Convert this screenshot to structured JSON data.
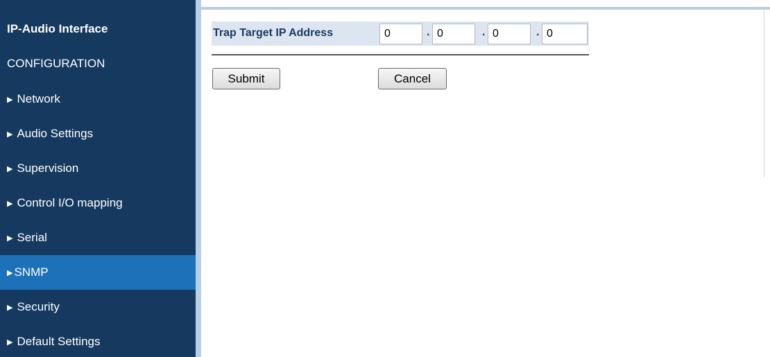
{
  "sidebar": {
    "title": "IP-Audio Interface",
    "section": "CONFIGURATION",
    "arrow": "▶",
    "items": [
      {
        "label": "Network"
      },
      {
        "label": "Audio Settings"
      },
      {
        "label": "Supervision"
      },
      {
        "label": "Control I/O mapping"
      },
      {
        "label": "Serial"
      },
      {
        "label": "SNMP",
        "active": true
      },
      {
        "label": "Security"
      },
      {
        "label": "Default Settings"
      }
    ]
  },
  "form": {
    "label": "Trap Target IP Address",
    "ip": [
      "0",
      "0",
      "0",
      "0"
    ],
    "separator": "."
  },
  "buttons": {
    "submit": "Submit",
    "cancel": "Cancel"
  },
  "colors": {
    "sidebar_bg": "#163a5f",
    "active_bg": "#1d71b8",
    "label_color": "#1b3a63"
  }
}
